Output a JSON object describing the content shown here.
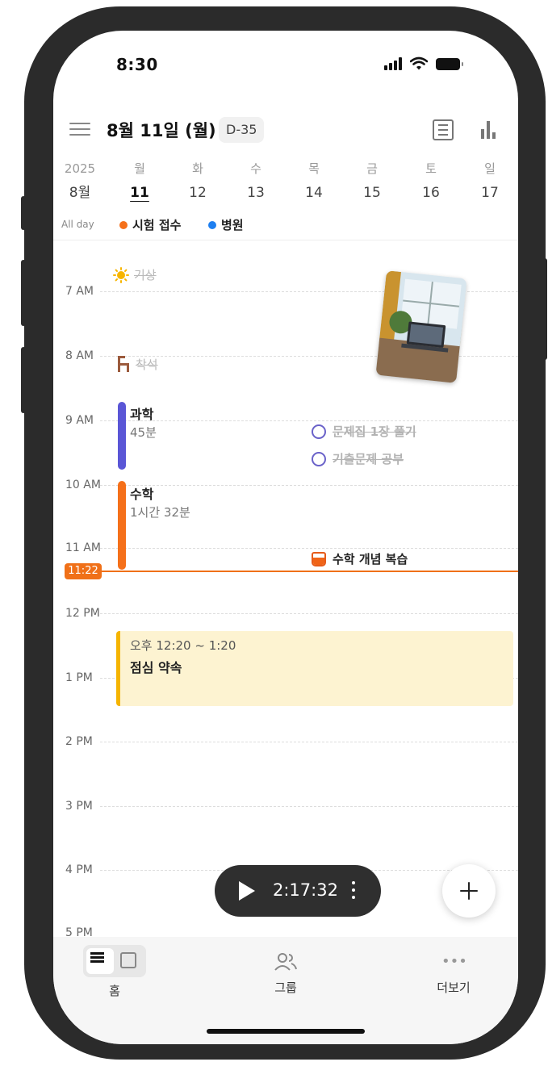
{
  "status_bar": {
    "time": "8:30"
  },
  "header": {
    "title": "8월 11일 (월)",
    "dday": "D-35",
    "list_view_icon": "list-icon",
    "stats_icon": "bar-chart-icon",
    "menu_icon": "hamburger-icon"
  },
  "week": {
    "year": "2025",
    "month": "8월",
    "days": [
      {
        "weekday": "월",
        "date": "11",
        "selected": true
      },
      {
        "weekday": "화",
        "date": "12"
      },
      {
        "weekday": "수",
        "date": "13"
      },
      {
        "weekday": "목",
        "date": "14"
      },
      {
        "weekday": "금",
        "date": "15"
      },
      {
        "weekday": "토",
        "date": "16"
      },
      {
        "weekday": "일",
        "date": "17"
      }
    ]
  },
  "allday": {
    "label": "All day",
    "events": [
      {
        "title": "시험 접수",
        "color": "#f5701a"
      },
      {
        "title": "병원",
        "color": "#1e7ff0"
      }
    ]
  },
  "hours": [
    "7 AM",
    "8 AM",
    "9 AM",
    "10 AM",
    "11 AM",
    "12 PM",
    "1 PM",
    "2 PM",
    "3 PM",
    "4 PM",
    "5 PM"
  ],
  "routines": [
    {
      "title": "기상",
      "icon": "sun-icon"
    },
    {
      "title": "착석",
      "icon": "chair-icon"
    }
  ],
  "events": [
    {
      "title": "과학",
      "duration": "45분",
      "color": "#5a56d6"
    },
    {
      "title": "수학",
      "duration": "1시간 32분",
      "color": "#f5701a"
    }
  ],
  "tasks": [
    {
      "title": "문제집 1장 풀기",
      "done": true
    },
    {
      "title": "기출문제 공부",
      "done": true
    },
    {
      "title": "수학 개념 복습",
      "done": false
    }
  ],
  "now": {
    "time": "11:22",
    "color": "#f07018"
  },
  "appointment": {
    "time": "오후 12:20 ~ 1:20",
    "title": "점심 약속",
    "color": "#f5b400"
  },
  "timer": {
    "value": "2:17:32"
  },
  "bottom_nav": [
    {
      "label": "홈"
    },
    {
      "label": "그룹"
    },
    {
      "label": "더보기"
    }
  ]
}
